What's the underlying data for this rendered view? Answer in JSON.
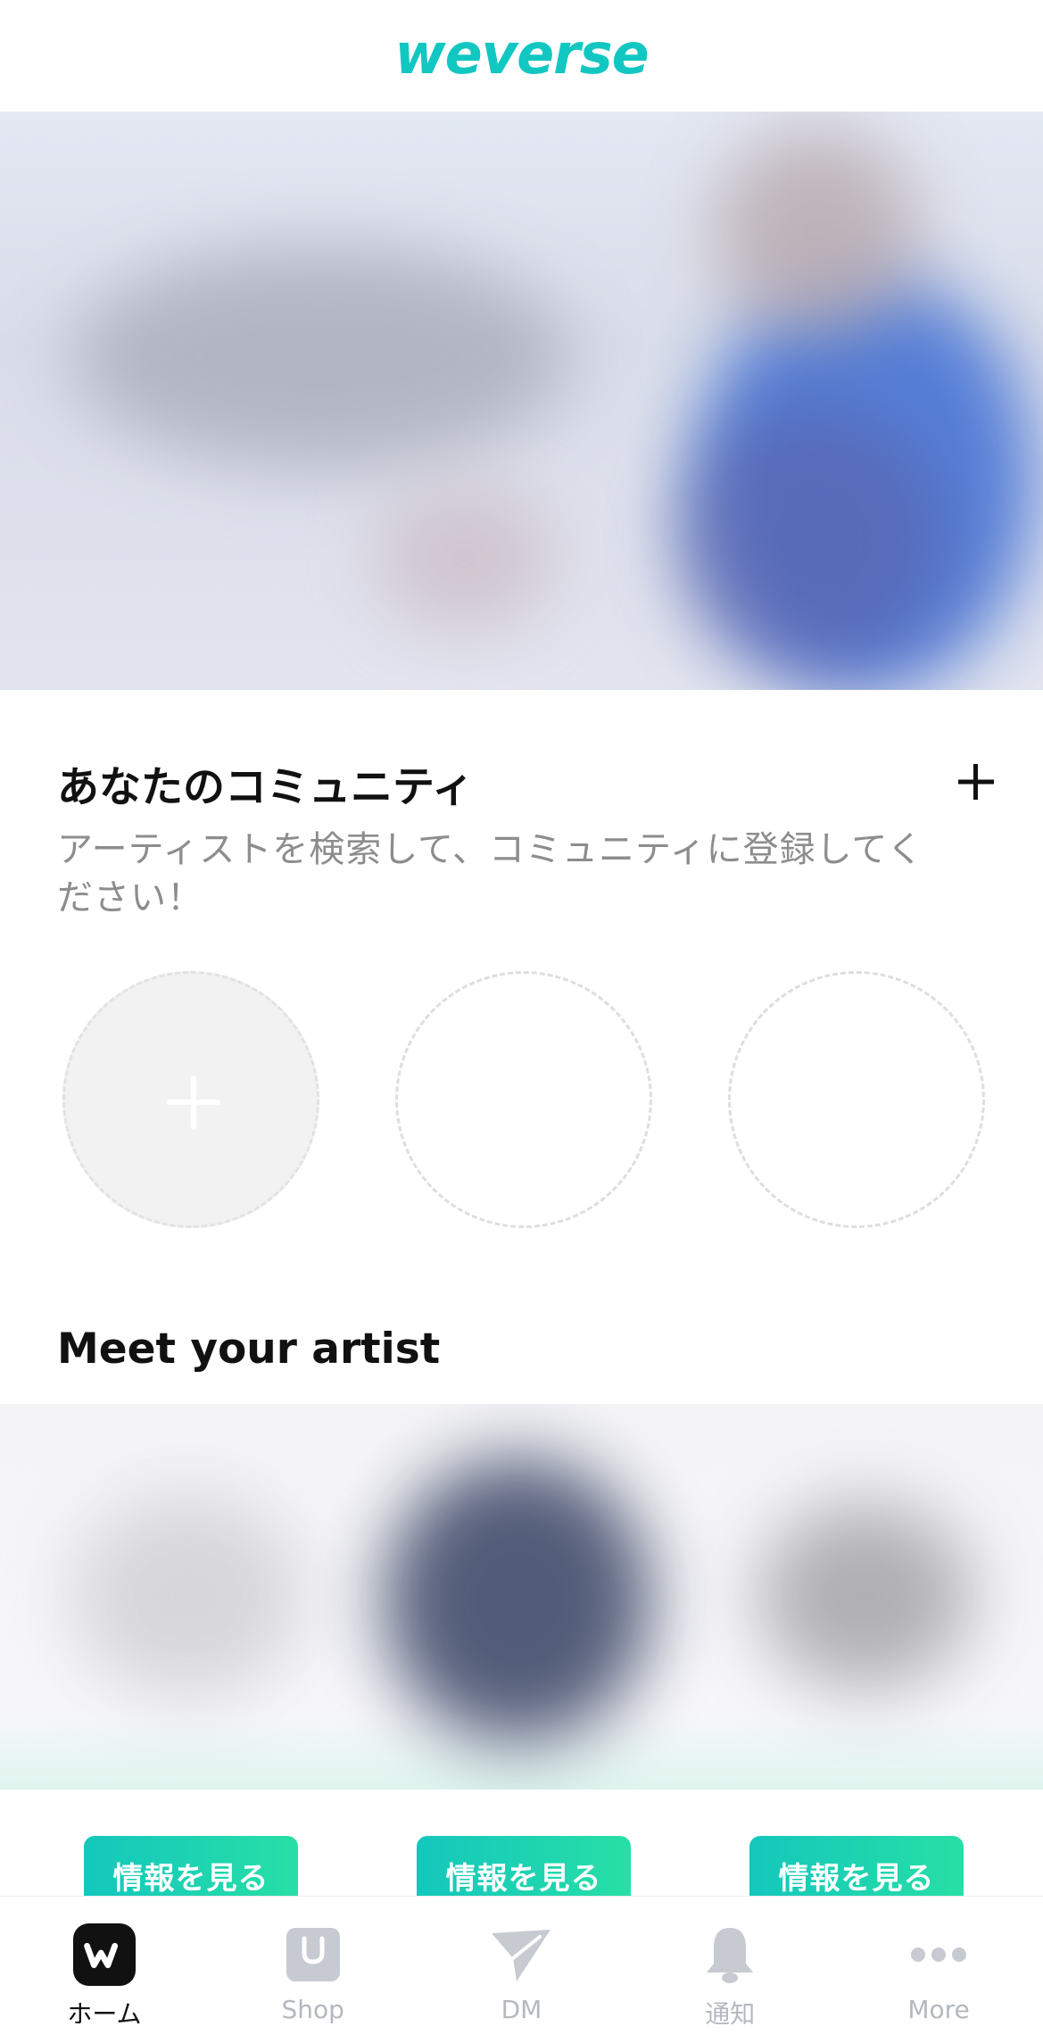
{
  "header": {
    "logo_text": "weverse",
    "logo_color": "#12c7c2"
  },
  "community": {
    "title": "あなたのコミュニティ",
    "subtitle": "アーティストを検索して、コミュニティに登録してください！"
  },
  "meet": {
    "title": "Meet your artist",
    "buttons": [
      "情報を見る",
      "情報を見る",
      "情報を見る"
    ]
  },
  "tabbar": {
    "tabs": [
      {
        "label": "ホーム",
        "icon": "weverse-home-icon",
        "active": true
      },
      {
        "label": "Shop",
        "icon": "shopping-bag-icon"
      },
      {
        "label": "DM",
        "icon": "send-icon"
      },
      {
        "label": "通知",
        "icon": "bell-icon"
      },
      {
        "label": "More",
        "icon": "more-dots-icon"
      }
    ]
  },
  "colors": {
    "accent": "#12c7c2",
    "button_gradient_end": "#27dfa5",
    "inactive_tab": "#b4b8bf"
  }
}
